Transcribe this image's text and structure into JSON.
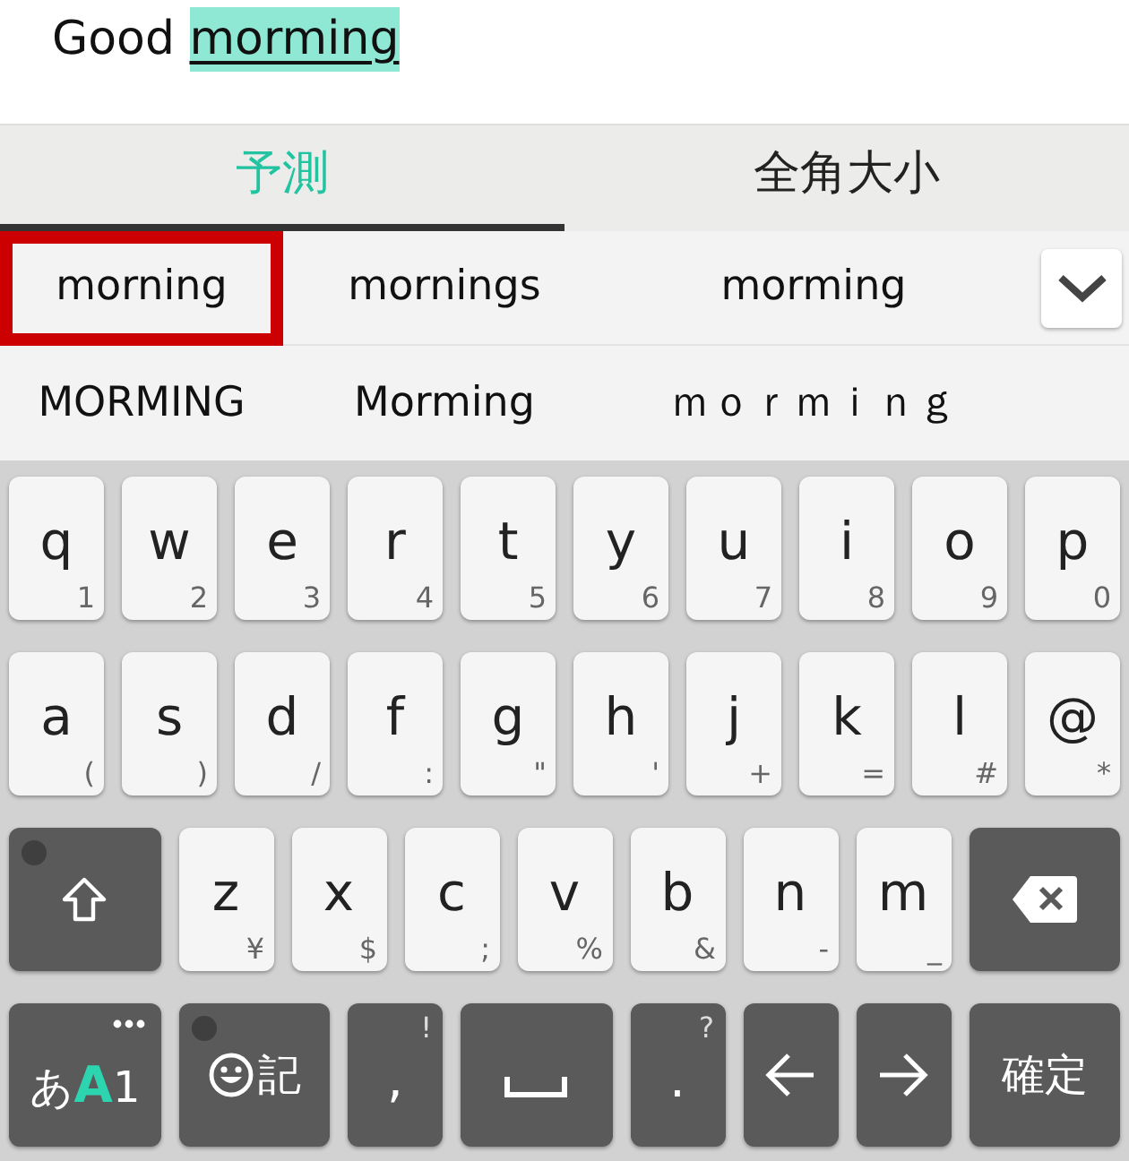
{
  "editor": {
    "text": "Good",
    "composing": "morming"
  },
  "tabs": [
    {
      "label": "予測",
      "selected": true
    },
    {
      "label": "全角大小",
      "selected": false
    }
  ],
  "candidates": [
    [
      {
        "text": "morning",
        "selected": true
      },
      {
        "text": "mornings",
        "selected": false
      },
      {
        "text": "morming",
        "selected": false
      }
    ],
    [
      {
        "text": "MORMING",
        "selected": false
      },
      {
        "text": "Morming",
        "selected": false
      },
      {
        "text": "ｍｏｒｍｉｎｇ",
        "selected": false
      }
    ]
  ],
  "keyboard": {
    "rows": [
      {
        "keys": [
          {
            "kind": "letter",
            "label": "q",
            "sub": "1"
          },
          {
            "kind": "letter",
            "label": "w",
            "sub": "2"
          },
          {
            "kind": "letter",
            "label": "e",
            "sub": "3"
          },
          {
            "kind": "letter",
            "label": "r",
            "sub": "4"
          },
          {
            "kind": "letter",
            "label": "t",
            "sub": "5"
          },
          {
            "kind": "letter",
            "label": "y",
            "sub": "6"
          },
          {
            "kind": "letter",
            "label": "u",
            "sub": "7"
          },
          {
            "kind": "letter",
            "label": "i",
            "sub": "8"
          },
          {
            "kind": "letter",
            "label": "o",
            "sub": "9"
          },
          {
            "kind": "letter",
            "label": "p",
            "sub": "0"
          }
        ]
      },
      {
        "keys": [
          {
            "kind": "letter",
            "label": "a",
            "sub": "("
          },
          {
            "kind": "letter",
            "label": "s",
            "sub": ")"
          },
          {
            "kind": "letter",
            "label": "d",
            "sub": "/"
          },
          {
            "kind": "letter",
            "label": "f",
            "sub": ":"
          },
          {
            "kind": "letter",
            "label": "g",
            "sub": "\""
          },
          {
            "kind": "letter",
            "label": "h",
            "sub": "'"
          },
          {
            "kind": "letter",
            "label": "j",
            "sub": "+"
          },
          {
            "kind": "letter",
            "label": "k",
            "sub": "="
          },
          {
            "kind": "letter",
            "label": "l",
            "sub": "#"
          },
          {
            "kind": "letter",
            "label": "@",
            "sub": "*"
          }
        ]
      },
      {
        "keys": [
          {
            "kind": "shift",
            "dot": true
          },
          {
            "kind": "letter",
            "label": "z",
            "sub": "¥"
          },
          {
            "kind": "letter",
            "label": "x",
            "sub": "$"
          },
          {
            "kind": "letter",
            "label": "c",
            "sub": ";"
          },
          {
            "kind": "letter",
            "label": "v",
            "sub": "%"
          },
          {
            "kind": "letter",
            "label": "b",
            "sub": "&"
          },
          {
            "kind": "letter",
            "label": "n",
            "sub": "-"
          },
          {
            "kind": "letter",
            "label": "m",
            "sub": "_"
          },
          {
            "kind": "backspace"
          }
        ]
      },
      {
        "keys": [
          {
            "kind": "mode",
            "parts": [
              {
                "text": "あ",
                "active": false
              },
              {
                "text": "A",
                "active": true
              },
              {
                "text": "1",
                "active": false
              }
            ]
          },
          {
            "kind": "emoji",
            "label": "記",
            "dot": true
          },
          {
            "kind": "punct",
            "label": ",",
            "sub": "!"
          },
          {
            "kind": "space"
          },
          {
            "kind": "punct",
            "label": ".",
            "sub": "?"
          },
          {
            "kind": "left"
          },
          {
            "kind": "right"
          },
          {
            "kind": "confirm",
            "label": "確定"
          }
        ]
      }
    ]
  }
}
